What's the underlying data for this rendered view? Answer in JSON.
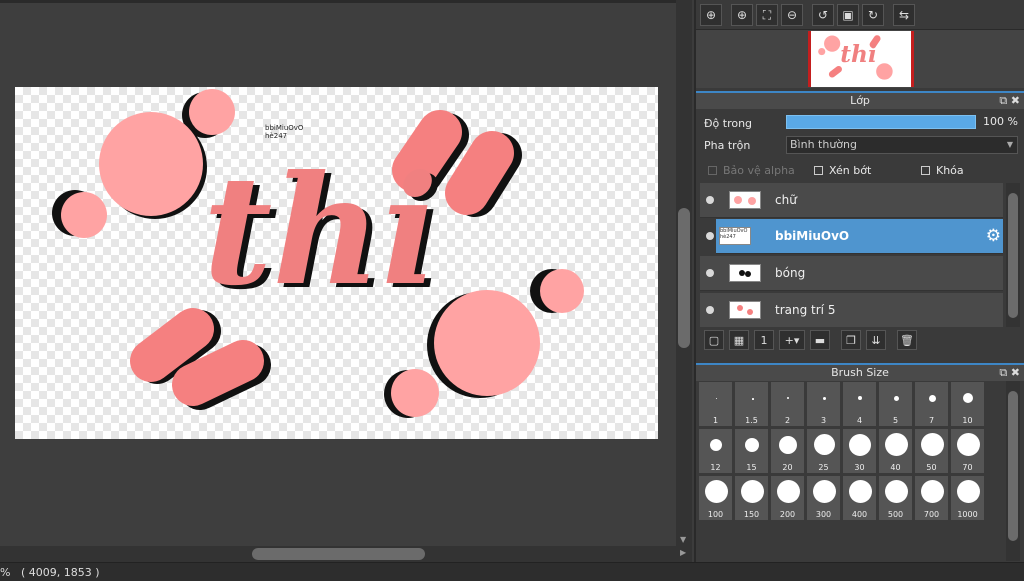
{
  "status": {
    "text": "%   ( 4009, 1853 )"
  },
  "canvas": {
    "small_text_line1": "bbiMiuOvO",
    "small_text_line2": "hè247",
    "art_word": "thi"
  },
  "colors": {
    "accent": "#4f95cf",
    "pink_light": "#ffa3a3",
    "pink_mid": "#f58080",
    "shadow": "#111111"
  },
  "toolbar_icons": [
    "zoom-fit-icon",
    "zoom-in-icon",
    "fit-window-icon",
    "zoom-out-icon",
    "rotate-left-icon",
    "reset-view-icon",
    "rotate-right-icon",
    "flip-icon"
  ],
  "layers_panel": {
    "title": "Lớp",
    "opacity_label": "Độ trong",
    "opacity_value": "100 %",
    "opacity_fraction": 1.0,
    "blend_label": "Pha trộn",
    "blend_value": "Bình thường",
    "protect_alpha": "Bảo vệ alpha",
    "clipping": "Xén bớt",
    "lock": "Khóa",
    "layers": [
      {
        "name": "chữ",
        "selected": false
      },
      {
        "name": "bbiMiuOvO",
        "selected": true
      },
      {
        "name": "bóng",
        "selected": false
      },
      {
        "name": "trang trí 5",
        "selected": false
      }
    ],
    "selected_thumb_line1": "bbiMiuOvO",
    "selected_thumb_line2": "hè247"
  },
  "brush_panel": {
    "title": "Brush Size",
    "sizes": [
      "1",
      "1.5",
      "2",
      "3",
      "4",
      "5",
      "7",
      "10",
      "12",
      "15",
      "20",
      "25",
      "30",
      "40",
      "50",
      "70",
      "100",
      "150",
      "200",
      "300",
      "400",
      "500",
      "700",
      "1000"
    ]
  }
}
